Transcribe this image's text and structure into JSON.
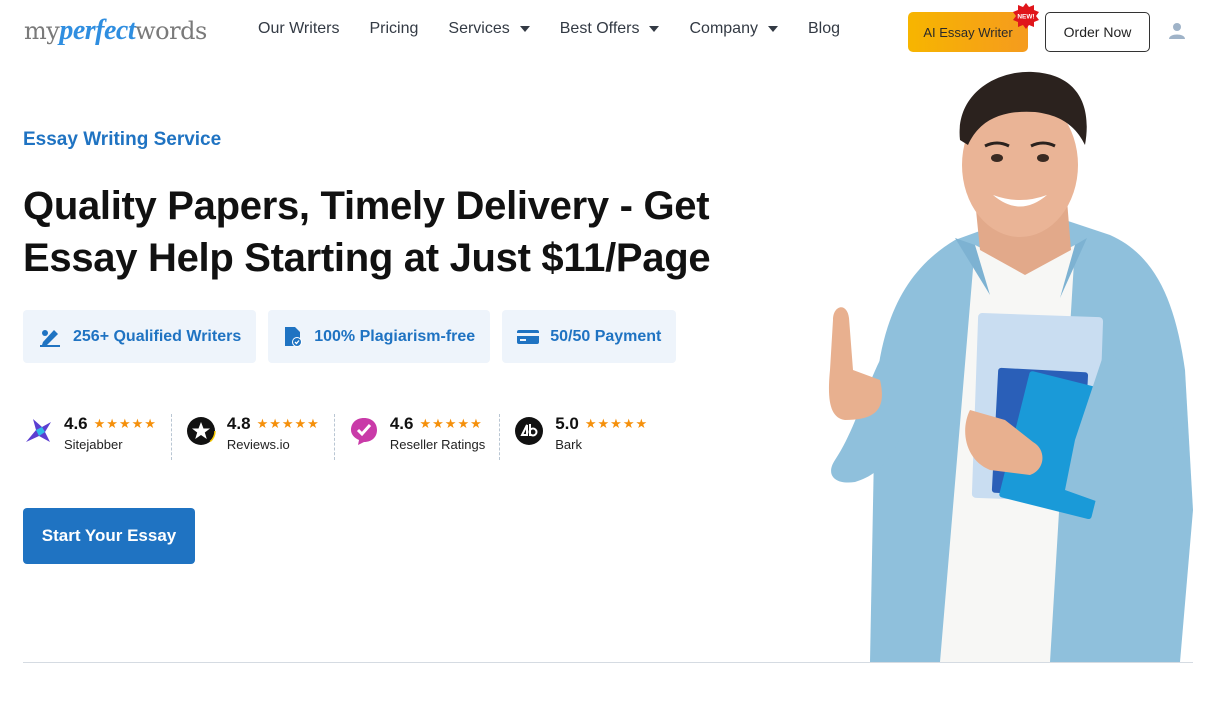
{
  "header": {
    "logo": {
      "my": "my",
      "perfect": "perfect",
      "words": "words"
    },
    "nav": [
      {
        "label": "Our Writers",
        "dropdown": false
      },
      {
        "label": "Pricing",
        "dropdown": false
      },
      {
        "label": "Services",
        "dropdown": true
      },
      {
        "label": "Best Offers",
        "dropdown": true
      },
      {
        "label": "Company",
        "dropdown": true
      },
      {
        "label": "Blog",
        "dropdown": false
      }
    ],
    "ai_button": "AI Essay Writer",
    "new_badge": "NEW!",
    "order_button": "Order Now",
    "user_icon": "user-icon"
  },
  "hero": {
    "eyebrow": "Essay Writing Service",
    "headline_line1": "Quality Papers, Timely Delivery - Get",
    "headline_line2": "Essay Help Starting at Just $11/Page",
    "features": [
      {
        "icon": "pen-writer-icon",
        "label": "256+ Qualified Writers"
      },
      {
        "icon": "document-check-icon",
        "label": "100% Plagiarism-free"
      },
      {
        "icon": "credit-card-icon",
        "label": "50/50 Payment"
      }
    ],
    "ratings": [
      {
        "score": "4.6",
        "source": "Sitejabber",
        "stars": "★★★★★",
        "rating": 4.6,
        "icon": "sitejabber-icon"
      },
      {
        "score": "4.8",
        "source": "Reviews.io",
        "stars": "★★★★★",
        "rating": 4.8,
        "icon": "reviews-io-icon"
      },
      {
        "score": "4.6",
        "source": "Reseller Ratings",
        "stars": "★★★★★",
        "rating": 4.6,
        "icon": "reseller-ratings-icon"
      },
      {
        "score": "5.0",
        "source": "Bark",
        "stars": "★★★★★",
        "rating": 5.0,
        "icon": "bark-icon"
      }
    ],
    "cta": "Start Your Essay"
  },
  "colors": {
    "brand_blue": "#1f73c2",
    "ai_orange": "#f7b500",
    "star": "#f5900b",
    "feature_bg": "#eef4fb"
  }
}
